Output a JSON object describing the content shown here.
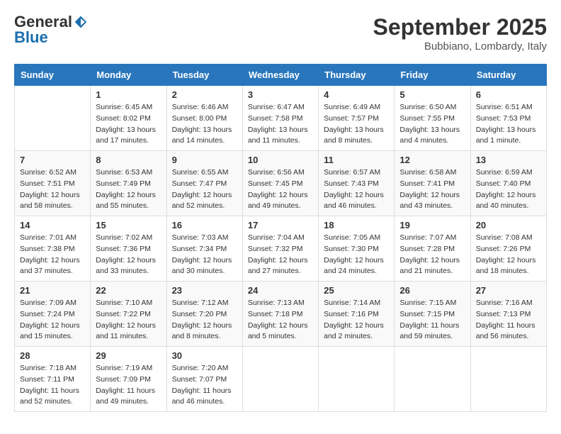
{
  "logo": {
    "general": "General",
    "blue": "Blue"
  },
  "title": "September 2025",
  "location": "Bubbiano, Lombardy, Italy",
  "weekdays": [
    "Sunday",
    "Monday",
    "Tuesday",
    "Wednesday",
    "Thursday",
    "Friday",
    "Saturday"
  ],
  "weeks": [
    [
      {
        "day": "",
        "sunrise": "",
        "sunset": "",
        "daylight": ""
      },
      {
        "day": "1",
        "sunrise": "Sunrise: 6:45 AM",
        "sunset": "Sunset: 8:02 PM",
        "daylight": "Daylight: 13 hours and 17 minutes."
      },
      {
        "day": "2",
        "sunrise": "Sunrise: 6:46 AM",
        "sunset": "Sunset: 8:00 PM",
        "daylight": "Daylight: 13 hours and 14 minutes."
      },
      {
        "day": "3",
        "sunrise": "Sunrise: 6:47 AM",
        "sunset": "Sunset: 7:58 PM",
        "daylight": "Daylight: 13 hours and 11 minutes."
      },
      {
        "day": "4",
        "sunrise": "Sunrise: 6:49 AM",
        "sunset": "Sunset: 7:57 PM",
        "daylight": "Daylight: 13 hours and 8 minutes."
      },
      {
        "day": "5",
        "sunrise": "Sunrise: 6:50 AM",
        "sunset": "Sunset: 7:55 PM",
        "daylight": "Daylight: 13 hours and 4 minutes."
      },
      {
        "day": "6",
        "sunrise": "Sunrise: 6:51 AM",
        "sunset": "Sunset: 7:53 PM",
        "daylight": "Daylight: 13 hours and 1 minute."
      }
    ],
    [
      {
        "day": "7",
        "sunrise": "Sunrise: 6:52 AM",
        "sunset": "Sunset: 7:51 PM",
        "daylight": "Daylight: 12 hours and 58 minutes."
      },
      {
        "day": "8",
        "sunrise": "Sunrise: 6:53 AM",
        "sunset": "Sunset: 7:49 PM",
        "daylight": "Daylight: 12 hours and 55 minutes."
      },
      {
        "day": "9",
        "sunrise": "Sunrise: 6:55 AM",
        "sunset": "Sunset: 7:47 PM",
        "daylight": "Daylight: 12 hours and 52 minutes."
      },
      {
        "day": "10",
        "sunrise": "Sunrise: 6:56 AM",
        "sunset": "Sunset: 7:45 PM",
        "daylight": "Daylight: 12 hours and 49 minutes."
      },
      {
        "day": "11",
        "sunrise": "Sunrise: 6:57 AM",
        "sunset": "Sunset: 7:43 PM",
        "daylight": "Daylight: 12 hours and 46 minutes."
      },
      {
        "day": "12",
        "sunrise": "Sunrise: 6:58 AM",
        "sunset": "Sunset: 7:41 PM",
        "daylight": "Daylight: 12 hours and 43 minutes."
      },
      {
        "day": "13",
        "sunrise": "Sunrise: 6:59 AM",
        "sunset": "Sunset: 7:40 PM",
        "daylight": "Daylight: 12 hours and 40 minutes."
      }
    ],
    [
      {
        "day": "14",
        "sunrise": "Sunrise: 7:01 AM",
        "sunset": "Sunset: 7:38 PM",
        "daylight": "Daylight: 12 hours and 37 minutes."
      },
      {
        "day": "15",
        "sunrise": "Sunrise: 7:02 AM",
        "sunset": "Sunset: 7:36 PM",
        "daylight": "Daylight: 12 hours and 33 minutes."
      },
      {
        "day": "16",
        "sunrise": "Sunrise: 7:03 AM",
        "sunset": "Sunset: 7:34 PM",
        "daylight": "Daylight: 12 hours and 30 minutes."
      },
      {
        "day": "17",
        "sunrise": "Sunrise: 7:04 AM",
        "sunset": "Sunset: 7:32 PM",
        "daylight": "Daylight: 12 hours and 27 minutes."
      },
      {
        "day": "18",
        "sunrise": "Sunrise: 7:05 AM",
        "sunset": "Sunset: 7:30 PM",
        "daylight": "Daylight: 12 hours and 24 minutes."
      },
      {
        "day": "19",
        "sunrise": "Sunrise: 7:07 AM",
        "sunset": "Sunset: 7:28 PM",
        "daylight": "Daylight: 12 hours and 21 minutes."
      },
      {
        "day": "20",
        "sunrise": "Sunrise: 7:08 AM",
        "sunset": "Sunset: 7:26 PM",
        "daylight": "Daylight: 12 hours and 18 minutes."
      }
    ],
    [
      {
        "day": "21",
        "sunrise": "Sunrise: 7:09 AM",
        "sunset": "Sunset: 7:24 PM",
        "daylight": "Daylight: 12 hours and 15 minutes."
      },
      {
        "day": "22",
        "sunrise": "Sunrise: 7:10 AM",
        "sunset": "Sunset: 7:22 PM",
        "daylight": "Daylight: 12 hours and 11 minutes."
      },
      {
        "day": "23",
        "sunrise": "Sunrise: 7:12 AM",
        "sunset": "Sunset: 7:20 PM",
        "daylight": "Daylight: 12 hours and 8 minutes."
      },
      {
        "day": "24",
        "sunrise": "Sunrise: 7:13 AM",
        "sunset": "Sunset: 7:18 PM",
        "daylight": "Daylight: 12 hours and 5 minutes."
      },
      {
        "day": "25",
        "sunrise": "Sunrise: 7:14 AM",
        "sunset": "Sunset: 7:16 PM",
        "daylight": "Daylight: 12 hours and 2 minutes."
      },
      {
        "day": "26",
        "sunrise": "Sunrise: 7:15 AM",
        "sunset": "Sunset: 7:15 PM",
        "daylight": "Daylight: 11 hours and 59 minutes."
      },
      {
        "day": "27",
        "sunrise": "Sunrise: 7:16 AM",
        "sunset": "Sunset: 7:13 PM",
        "daylight": "Daylight: 11 hours and 56 minutes."
      }
    ],
    [
      {
        "day": "28",
        "sunrise": "Sunrise: 7:18 AM",
        "sunset": "Sunset: 7:11 PM",
        "daylight": "Daylight: 11 hours and 52 minutes."
      },
      {
        "day": "29",
        "sunrise": "Sunrise: 7:19 AM",
        "sunset": "Sunset: 7:09 PM",
        "daylight": "Daylight: 11 hours and 49 minutes."
      },
      {
        "day": "30",
        "sunrise": "Sunrise: 7:20 AM",
        "sunset": "Sunset: 7:07 PM",
        "daylight": "Daylight: 11 hours and 46 minutes."
      },
      {
        "day": "",
        "sunrise": "",
        "sunset": "",
        "daylight": ""
      },
      {
        "day": "",
        "sunrise": "",
        "sunset": "",
        "daylight": ""
      },
      {
        "day": "",
        "sunrise": "",
        "sunset": "",
        "daylight": ""
      },
      {
        "day": "",
        "sunrise": "",
        "sunset": "",
        "daylight": ""
      }
    ]
  ]
}
